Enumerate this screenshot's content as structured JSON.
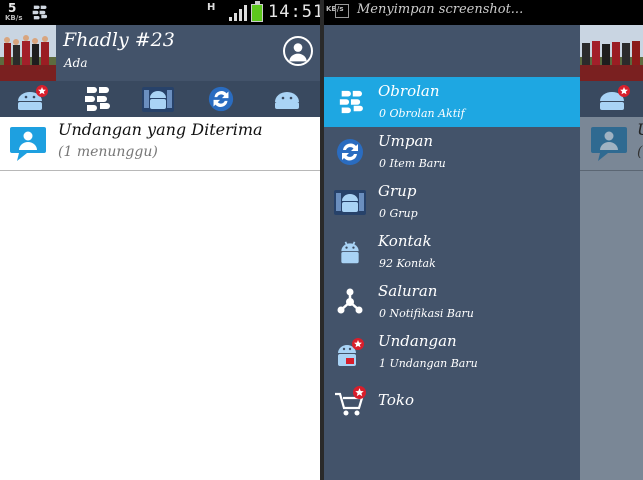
{
  "status_bar": {
    "speed_value": "5",
    "speed_unit": "KB/s",
    "network_type": "H",
    "time": "14:51"
  },
  "header": {
    "username": "Fhadly #23",
    "user_status": "Ada"
  },
  "tabs": [
    {
      "icon": "bbm-android-icon"
    },
    {
      "icon": "bbm-logo-icon"
    },
    {
      "icon": "group-icon"
    },
    {
      "icon": "refresh-icon"
    },
    {
      "icon": "android-icon"
    }
  ],
  "invitations": {
    "title": "Undangan yang Diterima",
    "subtitle": "(1 menunggu)"
  },
  "notification": {
    "speed_unit": "KB/s",
    "text": "Menyimpan screenshot..."
  },
  "drawer": {
    "items": [
      {
        "label": "Obrolan",
        "sub": "0 Obrolan Aktif",
        "icon": "bbm-logo-icon",
        "active": true
      },
      {
        "label": "Umpan",
        "sub": "0 Item Baru",
        "icon": "refresh-icon",
        "active": false
      },
      {
        "label": "Grup",
        "sub": "0 Grup",
        "icon": "group-icon",
        "active": false
      },
      {
        "label": "Kontak",
        "sub": "92 Kontak",
        "icon": "contact-icon",
        "active": false
      },
      {
        "label": "Saluran",
        "sub": "0 Notifikasi Baru",
        "icon": "channel-icon",
        "active": false
      },
      {
        "label": "Undangan",
        "sub": "1 Undangan Baru",
        "icon": "invite-icon",
        "active": false
      },
      {
        "label": "Toko",
        "sub": "",
        "icon": "shop-cart-icon",
        "active": false
      }
    ]
  },
  "peek": {
    "row_title_fragment": "U",
    "row_sub_fragment": "("
  },
  "colors": {
    "header_bg": "#43536a",
    "tabbar_bg": "#39495f",
    "active_item": "#1ea7e2",
    "overlay": "#7a8796",
    "battery": "#5dc71c",
    "badge": "#d81e2b"
  }
}
